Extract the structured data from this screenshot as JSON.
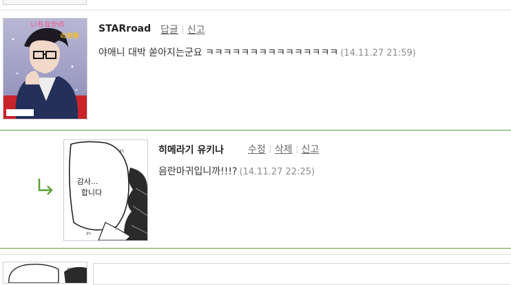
{
  "comments": [
    {
      "author": "STARroad",
      "actions": [
        "답글",
        "신고"
      ],
      "text": "야애니 대박 쏟아지는군요 ㅋㅋㅋㅋㅋㅋㅋㅋㅋㅋㅋㅋㅋㅋㅋ",
      "timestamp": "(14.11.27 21:59)",
      "avatar_text": [
        "いちなかの",
        "の奇跡"
      ]
    },
    {
      "author": "히메라기 유키나",
      "actions": [
        "수정",
        "삭제",
        "신고"
      ],
      "text": "음란마귀입니까!!!?",
      "timestamp": "(14.11.27 22:25)",
      "avatar_text": [
        "감사...",
        "합니다"
      ]
    }
  ],
  "icons": {
    "reply": "reply-arrow-icon"
  },
  "colors": {
    "divider_accent": "#5aa03a",
    "reply_arrow": "#5aa03a",
    "link": "#666666",
    "timestamp": "#8c8c8c"
  }
}
